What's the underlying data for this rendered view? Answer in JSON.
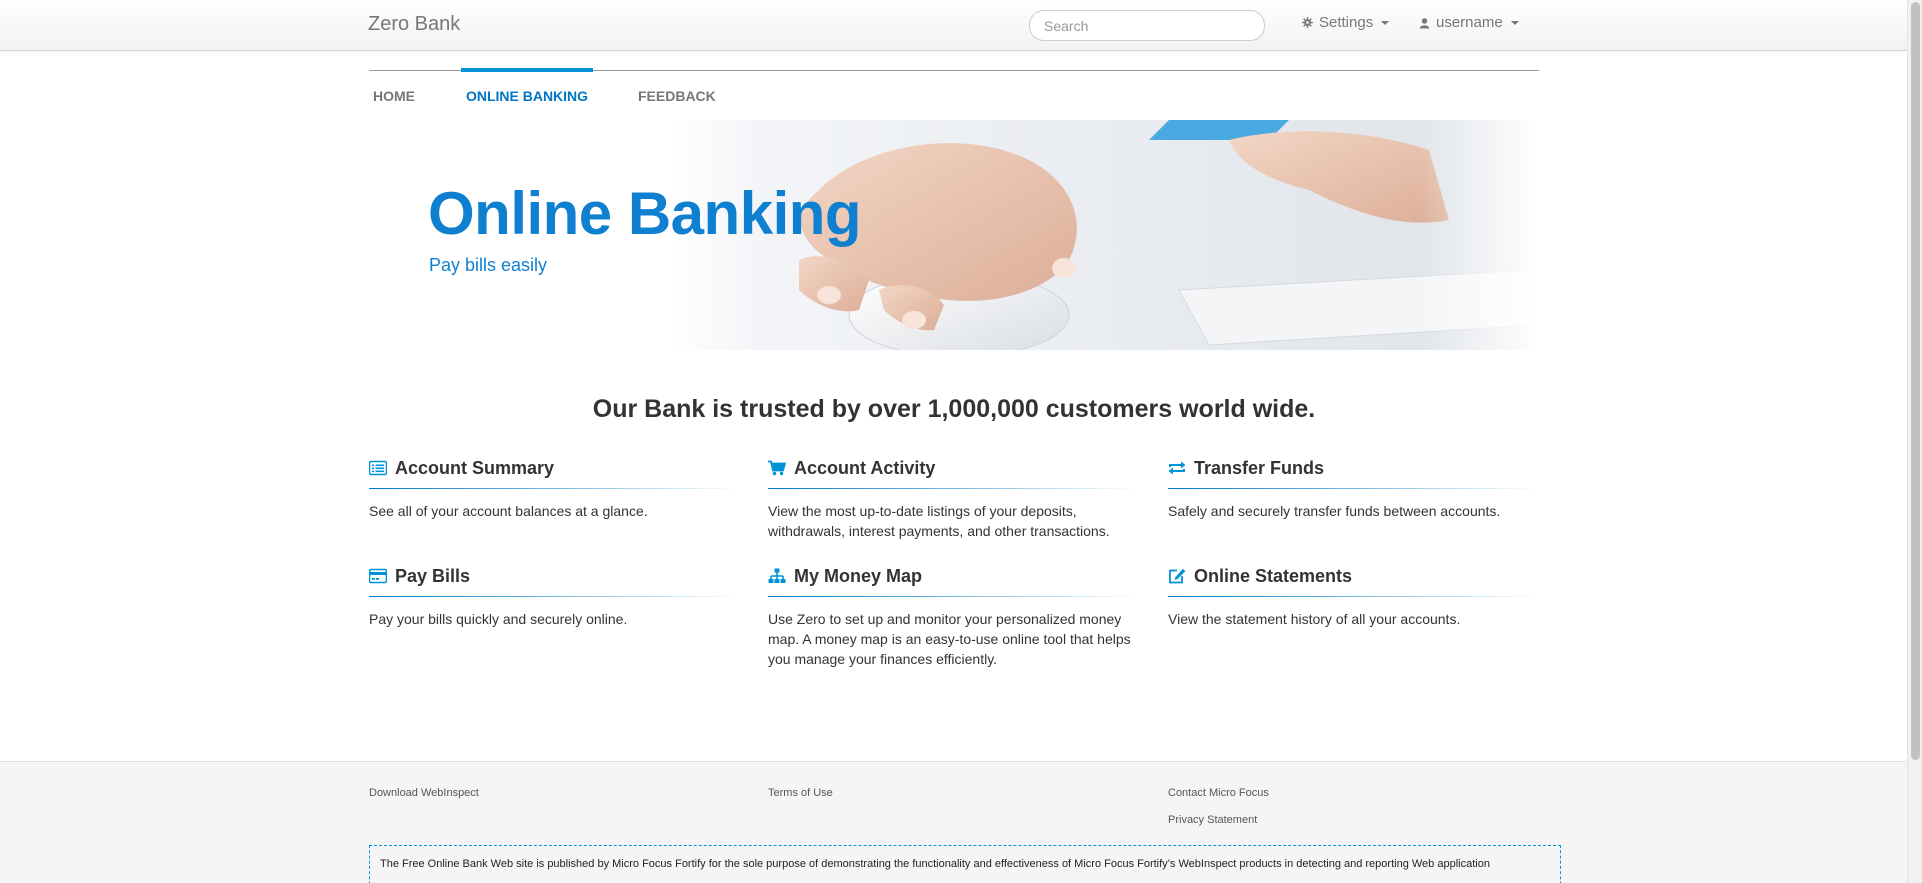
{
  "navbar": {
    "brand": "Zero Bank",
    "search_placeholder": "Search",
    "settings_label": "Settings",
    "user_label": "username"
  },
  "tabs": [
    {
      "label": "HOME",
      "active": false
    },
    {
      "label": "ONLINE BANKING",
      "active": true
    },
    {
      "label": "FEEDBACK",
      "active": false
    }
  ],
  "hero": {
    "title": "Online Banking",
    "subtitle": "Pay bills easily"
  },
  "headline": "Our Bank is trusted by over 1,000,000 customers world wide.",
  "features": [
    {
      "title": "Account Summary",
      "icon": "list-icon",
      "text": "See all of your account balances at a glance."
    },
    {
      "title": "Account Activity",
      "icon": "cart-icon",
      "text": "View the most up-to-date listings of your deposits, withdrawals, interest payments, and other transactions."
    },
    {
      "title": "Transfer Funds",
      "icon": "transfer-icon",
      "text": "Safely and securely transfer funds between accounts."
    },
    {
      "title": "Pay Bills",
      "icon": "credit-card-icon",
      "text": "Pay your bills quickly and securely online."
    },
    {
      "title": "My Money Map",
      "icon": "sitemap-icon",
      "text": "Use Zero to set up and monitor your personalized money map. A money map is an easy-to-use online tool that helps you manage your finances efficiently."
    },
    {
      "title": "Online Statements",
      "icon": "edit-icon",
      "text": "View the statement history of all your accounts."
    }
  ],
  "footer": {
    "download": "Download WebInspect",
    "terms": "Terms of Use",
    "contact": "Contact Micro Focus",
    "privacy": "Privacy Statement",
    "disclaimer": "The Free Online Bank Web site is published by Micro Focus Fortify for the sole purpose of demonstrating the functionality and effectiveness of Micro Focus Fortify’s WebInspect products in detecting and reporting Web application"
  },
  "colors": {
    "accent": "#0093d8",
    "hero_text": "#0f80d0",
    "active_tab": "#0074c5"
  }
}
